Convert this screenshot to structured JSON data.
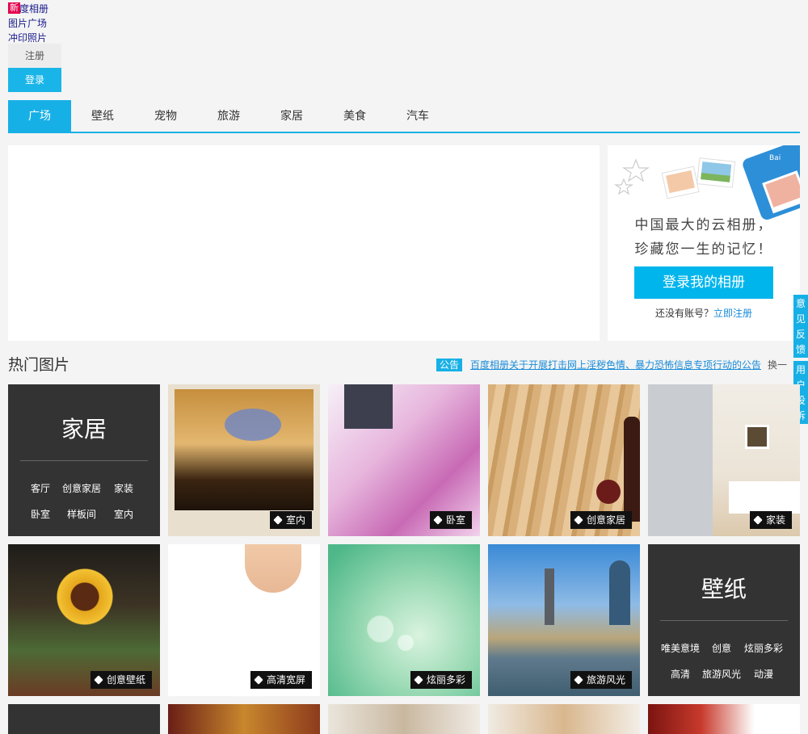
{
  "top_links": {
    "badge": "新",
    "album": "度相册",
    "plaza": "图片广场",
    "print": "冲印照片"
  },
  "auth": {
    "register": "注册",
    "login": "登录"
  },
  "nav": {
    "tabs": [
      "广场",
      "壁纸",
      "宠物",
      "旅游",
      "家居",
      "美食",
      "汽车"
    ]
  },
  "promo": {
    "line1": "中国最大的云相册，",
    "line2": "珍藏您一生的记忆！",
    "button": "登录我的相册",
    "no_account": "还没有账号？",
    "register_now": "立即注册"
  },
  "side": {
    "feedback": "意见反馈",
    "complaint": "用户投诉"
  },
  "hot": {
    "title": "热门图片",
    "notice_tag": "公告",
    "notice_text": "百度相册关于开展打击网上淫秽色情、暴力恐怖信息专项行动的公告",
    "change": "换一"
  },
  "categories": {
    "home": {
      "title": "家居",
      "links": [
        "客厅",
        "创意家居",
        "家装",
        "卧室",
        "样板间",
        "室内"
      ]
    },
    "wallpaper": {
      "title": "壁纸",
      "links": [
        "唯美意境",
        "创意",
        "炫丽多彩",
        "高清",
        "旅游风光",
        "动漫"
      ]
    }
  },
  "photos": {
    "p1": "室内",
    "p2": "卧室",
    "p3": "创意家居",
    "p4": "家装",
    "p5": "创意壁纸",
    "p6": "高清宽屏",
    "p7": "炫丽多彩",
    "p8": "旅游风光"
  },
  "colors": {
    "accent": "#17b0e6",
    "dark_tile": "#333333",
    "badge": "#e4004d"
  }
}
